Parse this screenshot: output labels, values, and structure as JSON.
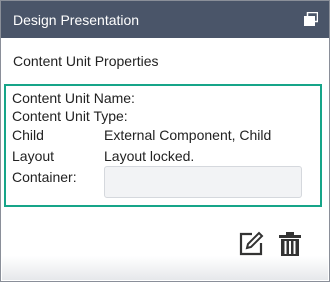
{
  "window": {
    "title": "Design Presentation",
    "restore_icon": "restore-window-icon"
  },
  "section": {
    "title": "Content Unit Properties"
  },
  "properties": {
    "content_unit_name_label": "Content Unit Name:",
    "content_unit_type_label": "Content Unit Type:",
    "child_label": "Child",
    "child_value": "External Component, Child",
    "layout_label": "Layout",
    "layout_value": "Layout locked.",
    "container_label": "Container:",
    "container_value": ""
  },
  "actions": {
    "edit_icon": "edit-icon",
    "delete_icon": "trash-icon"
  },
  "colors": {
    "titlebar": "#4a5569",
    "highlight_border": "#17a589",
    "icon": "#333333"
  }
}
